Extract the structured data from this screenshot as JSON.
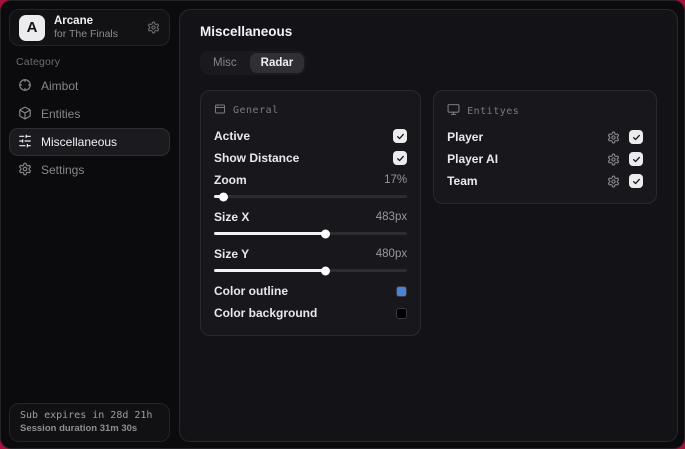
{
  "colors": {
    "backdrop": "#ab0f3d",
    "outline_swatch": "#4e82d6",
    "background_swatch": "#000000"
  },
  "sidebar": {
    "brand": {
      "initial": "A",
      "title": "Arcane",
      "subtitle": "for The Finals"
    },
    "category_label": "Category",
    "items": [
      {
        "label": "Aimbot",
        "icon": "crosshair-icon",
        "active": false
      },
      {
        "label": "Entities",
        "icon": "box-icon",
        "active": false
      },
      {
        "label": "Miscellaneous",
        "icon": "sliders-icon",
        "active": true
      },
      {
        "label": "Settings",
        "icon": "gear-icon",
        "active": false
      }
    ],
    "footer": {
      "line1": "Sub expires in 28d 21h",
      "line2": "Session duration 31m 30s"
    }
  },
  "main": {
    "title": "Miscellaneous",
    "tabs": [
      {
        "label": "Misc",
        "active": false
      },
      {
        "label": "Radar",
        "active": true
      }
    ],
    "general_panel": {
      "icon": "window-icon",
      "title": "General",
      "rows": [
        {
          "type": "checkbox",
          "label": "Active",
          "checked": true
        },
        {
          "type": "checkbox",
          "label": "Show Distance",
          "checked": true
        },
        {
          "type": "slider",
          "label": "Zoom",
          "value": "17%",
          "fill_percent": 5
        },
        {
          "type": "slider",
          "label": "Size X",
          "value": "483px",
          "fill_percent": 58
        },
        {
          "type": "slider",
          "label": "Size Y",
          "value": "480px",
          "fill_percent": 58
        },
        {
          "type": "color",
          "label": "Color outline",
          "color": "#4e82d6"
        },
        {
          "type": "color",
          "label": "Color background",
          "color": "#000000"
        }
      ]
    },
    "entities_panel": {
      "icon": "monitor-icon",
      "title": "Entityes",
      "rows": [
        {
          "label": "Player",
          "checked": true
        },
        {
          "label": "Player AI",
          "checked": true
        },
        {
          "label": "Team",
          "checked": true
        }
      ]
    }
  }
}
